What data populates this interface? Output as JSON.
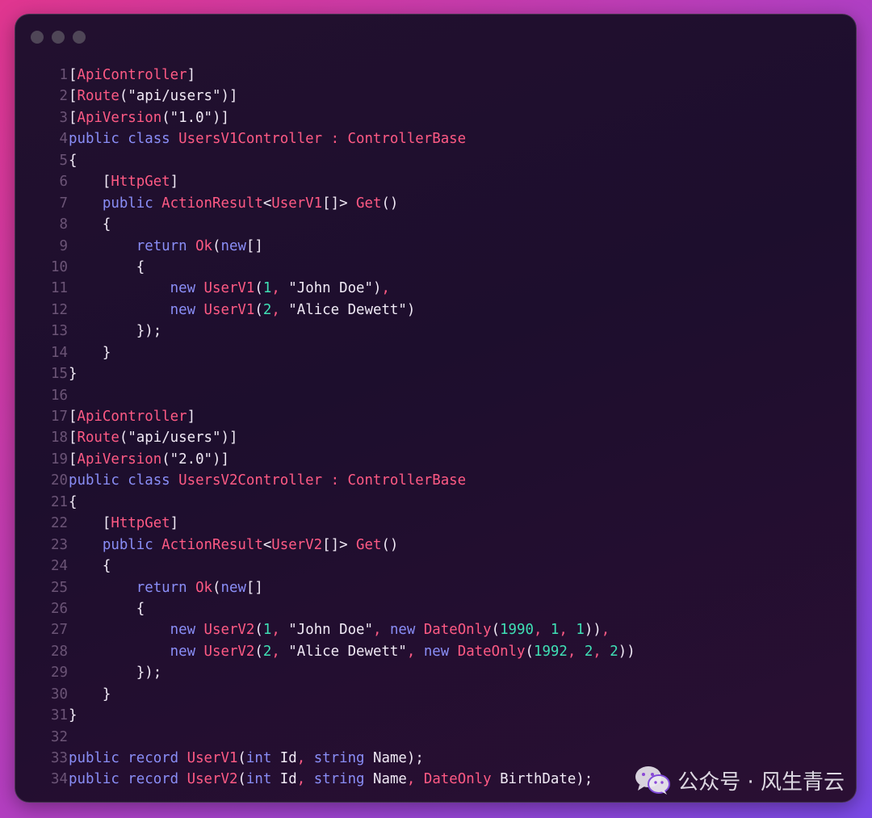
{
  "window": {
    "traffic_lights": [
      "close",
      "minimize",
      "zoom"
    ]
  },
  "code_lines": [
    {
      "n": "1",
      "tokens": [
        {
          "t": "[",
          "c": "p"
        },
        {
          "t": "ApiController",
          "c": "c"
        },
        {
          "t": "]",
          "c": "p"
        }
      ]
    },
    {
      "n": "2",
      "tokens": [
        {
          "t": "[",
          "c": "p"
        },
        {
          "t": "Route",
          "c": "c"
        },
        {
          "t": "(\"api/users\")]",
          "c": "p"
        }
      ]
    },
    {
      "n": "3",
      "tokens": [
        {
          "t": "[",
          "c": "p"
        },
        {
          "t": "ApiVersion",
          "c": "c"
        },
        {
          "t": "(\"1.0\")]",
          "c": "p"
        }
      ]
    },
    {
      "n": "4",
      "tokens": [
        {
          "t": "public class ",
          "c": "k"
        },
        {
          "t": "UsersV1Controller : ControllerBase",
          "c": "c"
        }
      ]
    },
    {
      "n": "5",
      "tokens": [
        {
          "t": "{",
          "c": "p"
        }
      ]
    },
    {
      "n": "6",
      "tokens": [
        {
          "t": "    [",
          "c": "p"
        },
        {
          "t": "HttpGet",
          "c": "c"
        },
        {
          "t": "]",
          "c": "p"
        }
      ]
    },
    {
      "n": "7",
      "tokens": [
        {
          "t": "    public ",
          "c": "k"
        },
        {
          "t": "ActionResult",
          "c": "c"
        },
        {
          "t": "<",
          "c": "p"
        },
        {
          "t": "UserV1",
          "c": "c"
        },
        {
          "t": "[]> ",
          "c": "p"
        },
        {
          "t": "Get",
          "c": "c"
        },
        {
          "t": "()",
          "c": "p"
        }
      ]
    },
    {
      "n": "8",
      "tokens": [
        {
          "t": "    {",
          "c": "p"
        }
      ]
    },
    {
      "n": "9",
      "tokens": [
        {
          "t": "        return ",
          "c": "k"
        },
        {
          "t": "Ok",
          "c": "c"
        },
        {
          "t": "(",
          "c": "p"
        },
        {
          "t": "new",
          "c": "k"
        },
        {
          "t": "[]",
          "c": "p"
        }
      ]
    },
    {
      "n": "10",
      "tokens": [
        {
          "t": "        {",
          "c": "p"
        }
      ]
    },
    {
      "n": "11",
      "tokens": [
        {
          "t": "            new ",
          "c": "k"
        },
        {
          "t": "UserV1",
          "c": "c"
        },
        {
          "t": "(",
          "c": "p"
        },
        {
          "t": "1",
          "c": "n"
        },
        {
          "t": ", ",
          "c": "c"
        },
        {
          "t": "\"John Doe\")",
          "c": "p"
        },
        {
          "t": ",",
          "c": "c"
        }
      ]
    },
    {
      "n": "12",
      "tokens": [
        {
          "t": "            new ",
          "c": "k"
        },
        {
          "t": "UserV1",
          "c": "c"
        },
        {
          "t": "(",
          "c": "p"
        },
        {
          "t": "2",
          "c": "n"
        },
        {
          "t": ", ",
          "c": "c"
        },
        {
          "t": "\"Alice Dewett\")",
          "c": "p"
        }
      ]
    },
    {
      "n": "13",
      "tokens": [
        {
          "t": "        });",
          "c": "p"
        }
      ]
    },
    {
      "n": "14",
      "tokens": [
        {
          "t": "    }",
          "c": "p"
        }
      ]
    },
    {
      "n": "15",
      "tokens": [
        {
          "t": "}",
          "c": "p"
        }
      ]
    },
    {
      "n": "16",
      "tokens": []
    },
    {
      "n": "17",
      "tokens": [
        {
          "t": "[",
          "c": "p"
        },
        {
          "t": "ApiController",
          "c": "c"
        },
        {
          "t": "]",
          "c": "p"
        }
      ]
    },
    {
      "n": "18",
      "tokens": [
        {
          "t": "[",
          "c": "p"
        },
        {
          "t": "Route",
          "c": "c"
        },
        {
          "t": "(\"api/users\")]",
          "c": "p"
        }
      ]
    },
    {
      "n": "19",
      "tokens": [
        {
          "t": "[",
          "c": "p"
        },
        {
          "t": "ApiVersion",
          "c": "c"
        },
        {
          "t": "(\"2.0\")]",
          "c": "p"
        }
      ]
    },
    {
      "n": "20",
      "tokens": [
        {
          "t": "public class ",
          "c": "k"
        },
        {
          "t": "UsersV2Controller : ControllerBase",
          "c": "c"
        }
      ]
    },
    {
      "n": "21",
      "tokens": [
        {
          "t": "{",
          "c": "p"
        }
      ]
    },
    {
      "n": "22",
      "tokens": [
        {
          "t": "    [",
          "c": "p"
        },
        {
          "t": "HttpGet",
          "c": "c"
        },
        {
          "t": "]",
          "c": "p"
        }
      ]
    },
    {
      "n": "23",
      "tokens": [
        {
          "t": "    public ",
          "c": "k"
        },
        {
          "t": "ActionResult",
          "c": "c"
        },
        {
          "t": "<",
          "c": "p"
        },
        {
          "t": "UserV2",
          "c": "c"
        },
        {
          "t": "[]> ",
          "c": "p"
        },
        {
          "t": "Get",
          "c": "c"
        },
        {
          "t": "()",
          "c": "p"
        }
      ]
    },
    {
      "n": "24",
      "tokens": [
        {
          "t": "    {",
          "c": "p"
        }
      ]
    },
    {
      "n": "25",
      "tokens": [
        {
          "t": "        return ",
          "c": "k"
        },
        {
          "t": "Ok",
          "c": "c"
        },
        {
          "t": "(",
          "c": "p"
        },
        {
          "t": "new",
          "c": "k"
        },
        {
          "t": "[]",
          "c": "p"
        }
      ]
    },
    {
      "n": "26",
      "tokens": [
        {
          "t": "        {",
          "c": "p"
        }
      ]
    },
    {
      "n": "27",
      "tokens": [
        {
          "t": "            new ",
          "c": "k"
        },
        {
          "t": "UserV2",
          "c": "c"
        },
        {
          "t": "(",
          "c": "p"
        },
        {
          "t": "1",
          "c": "n"
        },
        {
          "t": ", ",
          "c": "c"
        },
        {
          "t": "\"John Doe\"",
          "c": "p"
        },
        {
          "t": ", ",
          "c": "c"
        },
        {
          "t": "new ",
          "c": "k"
        },
        {
          "t": "DateOnly",
          "c": "c"
        },
        {
          "t": "(",
          "c": "p"
        },
        {
          "t": "1990",
          "c": "n"
        },
        {
          "t": ", ",
          "c": "c"
        },
        {
          "t": "1",
          "c": "n"
        },
        {
          "t": ", ",
          "c": "c"
        },
        {
          "t": "1",
          "c": "n"
        },
        {
          "t": "))",
          "c": "p"
        },
        {
          "t": ",",
          "c": "c"
        }
      ]
    },
    {
      "n": "28",
      "tokens": [
        {
          "t": "            new ",
          "c": "k"
        },
        {
          "t": "UserV2",
          "c": "c"
        },
        {
          "t": "(",
          "c": "p"
        },
        {
          "t": "2",
          "c": "n"
        },
        {
          "t": ", ",
          "c": "c"
        },
        {
          "t": "\"Alice Dewett\"",
          "c": "p"
        },
        {
          "t": ", ",
          "c": "c"
        },
        {
          "t": "new ",
          "c": "k"
        },
        {
          "t": "DateOnly",
          "c": "c"
        },
        {
          "t": "(",
          "c": "p"
        },
        {
          "t": "1992",
          "c": "n"
        },
        {
          "t": ", ",
          "c": "c"
        },
        {
          "t": "2",
          "c": "n"
        },
        {
          "t": ", ",
          "c": "c"
        },
        {
          "t": "2",
          "c": "n"
        },
        {
          "t": "))",
          "c": "p"
        }
      ]
    },
    {
      "n": "29",
      "tokens": [
        {
          "t": "        });",
          "c": "p"
        }
      ]
    },
    {
      "n": "30",
      "tokens": [
        {
          "t": "    }",
          "c": "p"
        }
      ]
    },
    {
      "n": "31",
      "tokens": [
        {
          "t": "}",
          "c": "p"
        }
      ]
    },
    {
      "n": "32",
      "tokens": []
    },
    {
      "n": "33",
      "tokens": [
        {
          "t": "public record ",
          "c": "k"
        },
        {
          "t": "UserV1",
          "c": "c"
        },
        {
          "t": "(",
          "c": "p"
        },
        {
          "t": "int ",
          "c": "k"
        },
        {
          "t": "Id",
          "c": "p"
        },
        {
          "t": ", ",
          "c": "c"
        },
        {
          "t": "string ",
          "c": "k"
        },
        {
          "t": "Name);",
          "c": "p"
        }
      ]
    },
    {
      "n": "34",
      "tokens": [
        {
          "t": "public record ",
          "c": "k"
        },
        {
          "t": "UserV2",
          "c": "c"
        },
        {
          "t": "(",
          "c": "p"
        },
        {
          "t": "int ",
          "c": "k"
        },
        {
          "t": "Id",
          "c": "p"
        },
        {
          "t": ", ",
          "c": "c"
        },
        {
          "t": "string ",
          "c": "k"
        },
        {
          "t": "Name",
          "c": "p"
        },
        {
          "t": ", ",
          "c": "c"
        },
        {
          "t": "DateOnly ",
          "c": "c"
        },
        {
          "t": "BirthDate);",
          "c": "p"
        }
      ]
    }
  ],
  "watermark": {
    "icon": "wechat-icon",
    "text": "公众号 · 风生青云"
  },
  "colors": {
    "background_gradient": [
      "#e0368f",
      "#b13fc2",
      "#7a49e6"
    ],
    "window_bg": "#22102f",
    "keyword": "#8a8ef7",
    "type_name": "#ff5a84",
    "number": "#3fe0b5",
    "plain": "#f0e9f5",
    "line_number": "#6b5476"
  }
}
